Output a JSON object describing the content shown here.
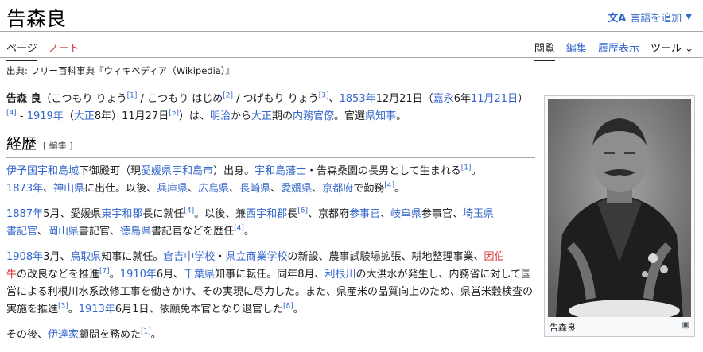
{
  "title": "告森良",
  "lang_button": {
    "label": "言語を追加"
  },
  "tabs_left": [
    {
      "label": "ページ",
      "selected": true
    },
    {
      "label": "ノート",
      "selected": false
    }
  ],
  "tabs_right": [
    {
      "label": "閲覧",
      "selected": true
    },
    {
      "label": "編集",
      "selected": false
    },
    {
      "label": "履歴表示",
      "selected": false
    },
    {
      "label": "ツール",
      "selected": false
    }
  ],
  "from": "出典: フリー百科事典『ウィキペディア（Wikipedia）』",
  "section_heading": "経歴",
  "edit_label": "[ 編集 ]",
  "infobox_caption": "告森良",
  "colors": {
    "link": "#3366cc",
    "redlink": "#d73333"
  }
}
